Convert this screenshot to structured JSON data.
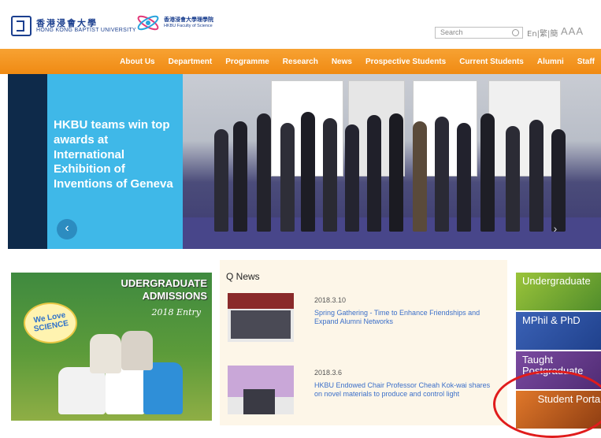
{
  "header": {
    "hkbu_logo_cn": "香港浸會大學",
    "hkbu_logo_en": "HONG KONG BAPTIST UNIVERSITY",
    "sci_logo_cn": "香港浸會大學理學院",
    "sci_logo_en": "HKBU Faculty of Science",
    "search_placeholder": "Search",
    "lang": "En|繁|簡",
    "font_size_label": "AAA"
  },
  "nav": {
    "items": [
      "About Us",
      "Department",
      "Programme",
      "Research",
      "News",
      "Prospective Students",
      "Current Students",
      "Alumni",
      "Staff"
    ]
  },
  "hero": {
    "caption": "HKBU teams win top awards at International Exhibition of Inventions of Geneva",
    "prev_icon": "chevron-left-icon",
    "next_icon": "chevron-right-icon"
  },
  "admissions": {
    "title_line1": "UDERGRADUATE",
    "title_line2": "ADMISSIONS",
    "subtitle": "2018 Entry",
    "bubble": "We Love SCIENCE"
  },
  "news": {
    "heading": "Q News",
    "items": [
      {
        "date": "2018.3.10",
        "title": "Spring Gathering - Time to Enhance Friendships and Expand Alumni Networks"
      },
      {
        "date": "2018.3.6",
        "title": "HKBU Endowed Chair Professor Cheah Kok-wai shares on novel materials to produce and control light"
      }
    ]
  },
  "tiles": [
    {
      "label": "Undergraduate",
      "color": "#7aa832"
    },
    {
      "label": "MPhil & PhD",
      "color": "#2f4ea0"
    },
    {
      "label": "Taught Postgraduate",
      "color": "#6a3a8a"
    },
    {
      "label": "Student Portal",
      "color": "#c25a14"
    }
  ],
  "colors": {
    "nav": "#f08a12",
    "caption_bg": "#3fb8e8",
    "highlight": "#e01c1c"
  }
}
